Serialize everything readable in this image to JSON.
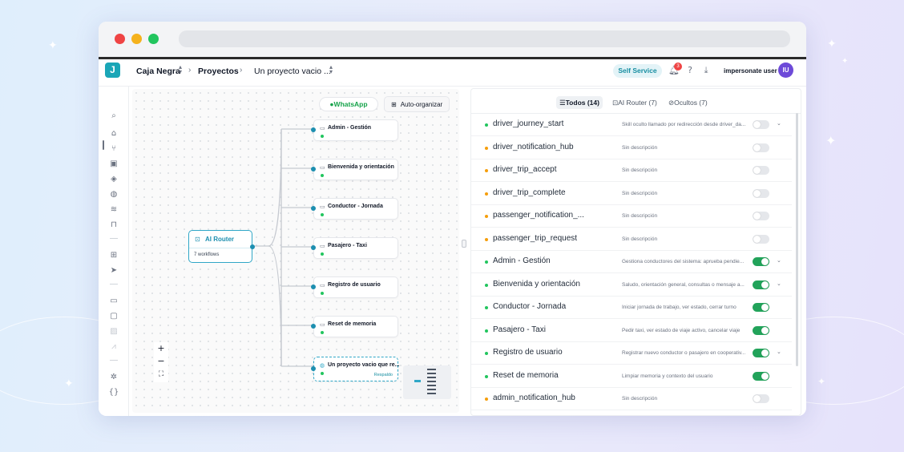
{
  "header": {
    "logo": "J",
    "workspace": "Caja Negra",
    "section": "Proyectos",
    "project": "Un proyecto vacio ...",
    "self_service": "Self Service",
    "notif_count": "3",
    "user_label": "impersonate user",
    "avatar_initials": "IU"
  },
  "canvas": {
    "whatsapp": "WhatsApp",
    "auto_organize": "Auto-organizar",
    "router": {
      "title": "AI Router",
      "subtitle": "7 workflows"
    },
    "nodes": [
      {
        "label": "Admin - Gestión"
      },
      {
        "label": "Bienvenida y orientación"
      },
      {
        "label": "Conductor - Jornada"
      },
      {
        "label": "Pasajero - Taxi"
      },
      {
        "label": "Registro de usuario"
      },
      {
        "label": "Reset de memoria"
      },
      {
        "label": "Un proyecto vacio que re...",
        "tag": "Respaldo"
      }
    ],
    "zoom_in": "+",
    "zoom_out": "−",
    "fit": "⛶"
  },
  "tabs": {
    "all": "Todos (14)",
    "ai_router": "AI Router (7)",
    "hidden": "Ocultos (7)"
  },
  "colors": {
    "accent": "#1aa6b7",
    "green": "#22c55e",
    "orange": "#f59e0b",
    "toggle_on": "#22a35a"
  },
  "skills": [
    {
      "name": "driver_journey_start",
      "desc": "Skill oculto llamado por redirección desde driver_da...",
      "status": "green",
      "enabled": false,
      "chevron": true
    },
    {
      "name": "driver_notification_hub",
      "desc": "Sin descripción",
      "status": "orange",
      "enabled": false,
      "chevron": false
    },
    {
      "name": "driver_trip_accept",
      "desc": "Sin descripción",
      "status": "orange",
      "enabled": false,
      "chevron": false
    },
    {
      "name": "driver_trip_complete",
      "desc": "Sin descripción",
      "status": "orange",
      "enabled": false,
      "chevron": false
    },
    {
      "name": "passenger_notification_...",
      "desc": "Sin descripción",
      "status": "orange",
      "enabled": false,
      "chevron": false
    },
    {
      "name": "passenger_trip_request",
      "desc": "Sin descripción",
      "status": "orange",
      "enabled": false,
      "chevron": false
    },
    {
      "name": "Admin - Gestión",
      "desc": "Gestiona conductores del sistema: aprueba pendie...",
      "status": "green",
      "enabled": true,
      "chevron": true
    },
    {
      "name": "Bienvenida y orientación",
      "desc": "Saludo, orientación general, consultas o mensaje a...",
      "status": "green",
      "enabled": true,
      "chevron": true
    },
    {
      "name": "Conductor - Jornada",
      "desc": "Iniciar jornada de trabajo, ver estado, cerrar turno",
      "status": "green",
      "enabled": true,
      "chevron": false
    },
    {
      "name": "Pasajero - Taxi",
      "desc": "Pedir taxi, ver estado de viaje activo, cancelar viaje",
      "status": "green",
      "enabled": true,
      "chevron": false
    },
    {
      "name": "Registro de usuario",
      "desc": "Registrar nuevo conductor o pasajero en cooperativ...",
      "status": "green",
      "enabled": true,
      "chevron": true
    },
    {
      "name": "Reset de memoria",
      "desc": "Limpiar memoria y contexto del usuario",
      "status": "green",
      "enabled": true,
      "chevron": false
    },
    {
      "name": "admin_notification_hub",
      "desc": "Sin descripción",
      "status": "orange",
      "enabled": false,
      "chevron": false
    }
  ]
}
